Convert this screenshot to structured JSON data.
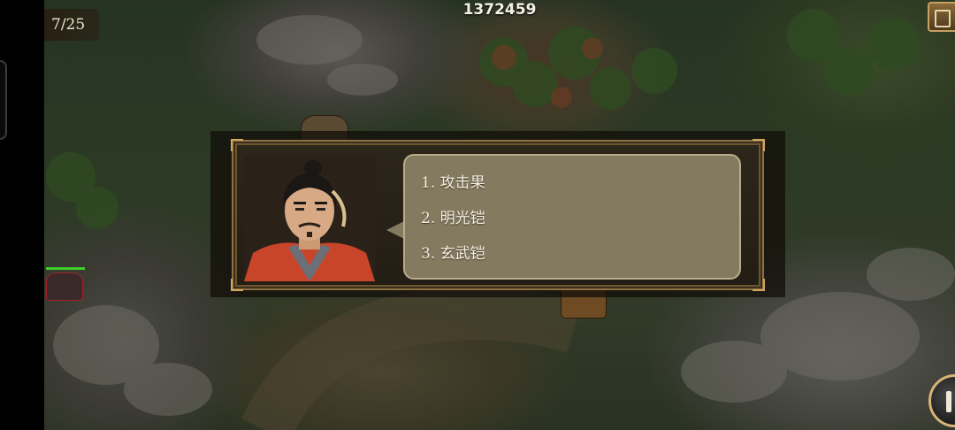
{
  "hud": {
    "turn_counter": "7/25",
    "score": "1372459"
  },
  "dialog": {
    "speaker_portrait": "general-portrait",
    "items": [
      {
        "label": "1. 攻击果"
      },
      {
        "label": "2. 明光铠"
      },
      {
        "label": "3. 玄武铠"
      }
    ]
  },
  "icons": {
    "menu": "menu-icon",
    "pause": "pause-icon"
  },
  "colors": {
    "hp_bar": "#3fcf2a",
    "dialog_frame": "#8d7043",
    "speech_bubble": "#847a60"
  }
}
